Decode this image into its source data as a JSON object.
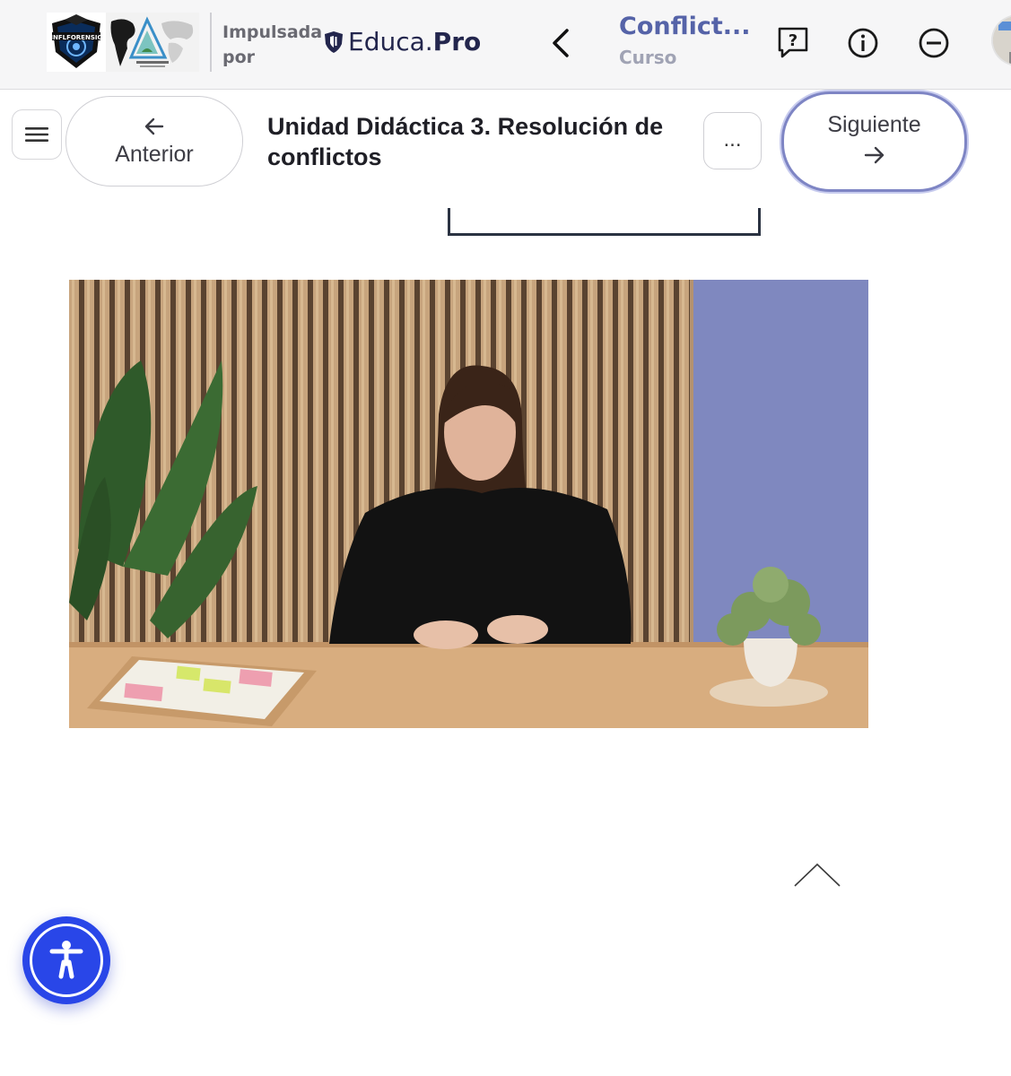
{
  "header": {
    "logo_text": "INFLFORENSIC",
    "powered_by": "Impulsada por",
    "brand_part1": "Educa",
    "brand_dot": ".",
    "brand_part2": "Pro",
    "course_title": "Conflict...",
    "course_subtitle": "Curso",
    "icons": [
      "back-chevron-icon",
      "help-icon",
      "info-icon",
      "minus-circle-icon"
    ]
  },
  "lesson_nav": {
    "menu_icon": "hamburger-icon",
    "prev_label": "Anterior",
    "title": "Unidad Didáctica 3. Resolución de conflictos",
    "more_label": "...",
    "next_label": "Siguiente"
  },
  "content": {
    "video_description_icon": "video-frame",
    "scroll_top_icon": "chevron-up-icon",
    "accessibility_icon": "accessibility-icon"
  },
  "colors": {
    "brand_navy": "#23264d",
    "course_title": "#5563a8",
    "accent_blue": "#2946e8",
    "next_border": "#7e85c4"
  }
}
